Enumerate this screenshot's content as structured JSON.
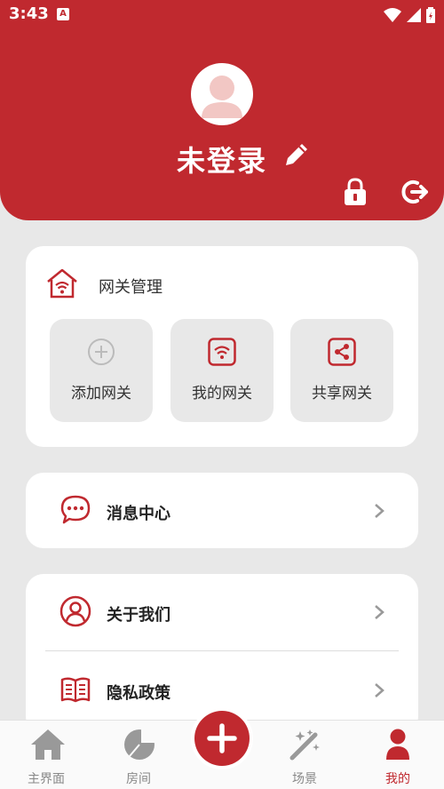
{
  "status_bar": {
    "time": "3:43",
    "notification_icon_glyph": "A"
  },
  "profile": {
    "username": "未登录"
  },
  "gateway": {
    "title": "网关管理",
    "tiles": [
      {
        "label": "添加网关",
        "icon": "plus-circle-icon"
      },
      {
        "label": "我的网关",
        "icon": "wifi-box-icon"
      },
      {
        "label": "共享网关",
        "icon": "share-box-icon"
      }
    ]
  },
  "menu": {
    "message_center": "消息中心",
    "about_us": "关于我们",
    "privacy_policy": "隐私政策"
  },
  "nav": {
    "home": "主界面",
    "rooms": "房间",
    "scenes": "场景",
    "mine": "我的"
  },
  "colors": {
    "accent": "#c0292f",
    "background": "#e8e8e8"
  }
}
